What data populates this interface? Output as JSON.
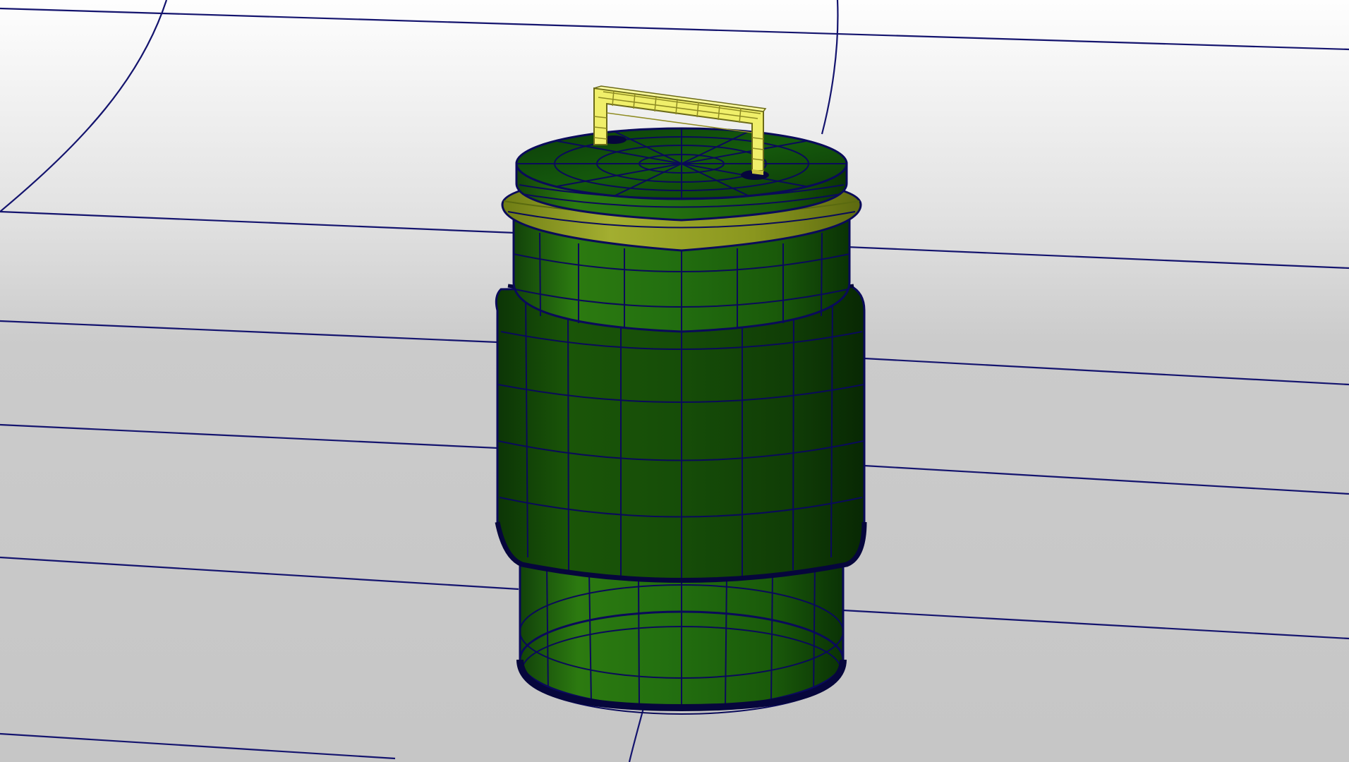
{
  "viewport": {
    "colors": {
      "background_top": "#fefefe",
      "background_bottom": "#c8c8c8",
      "grid_line": "#14146e",
      "mesh_line": "#0a0a5a",
      "body_green_light": "#2f7f0a",
      "body_green_dark": "#0c3a06",
      "top_rim": "#8a9a1e",
      "handle": "#f0ef6a",
      "handle_dark": "#c9c540"
    },
    "model_part": "air-spring"
  }
}
